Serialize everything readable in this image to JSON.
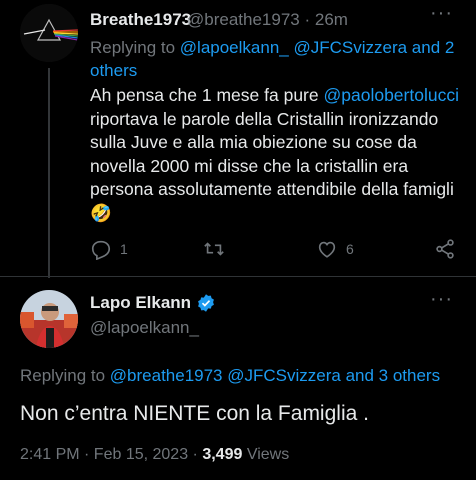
{
  "reply_tweet": {
    "display_name": "Breathe1973",
    "handle": "@breathe1973",
    "time": "26m",
    "replying_prefix": "Replying to ",
    "replying_to": "@lapoelkann_ @JFCSvizzera and 2 others",
    "mention": "@paolobertolucci",
    "text": " riportava le parole della Cristallin ironizzando sulla Juve e alla mia obiezione su cose da novella 2000 mi disse che la cristallin era persona assolutamente attendibile della famigli",
    "text_prefix": "Ah pensa che 1 mese fa pure ",
    "emoji": "🤣",
    "reply_count": "1",
    "retweet_count": "",
    "like_count": "6"
  },
  "main_tweet": {
    "display_name": "Lapo Elkann",
    "handle": "@lapoelkann_",
    "replying_prefix": "Replying to ",
    "replying_to": "@breathe1973 @JFCSvizzera and 3 others",
    "text": "Non c’entra NIENTE con la Famiglia .",
    "timestamp": "2:41 PM · Feb 15, 2023 · ",
    "views_count": "3,499",
    "views_label": " Views"
  },
  "icons": {
    "more": "more-dots-icon",
    "reply": "reply-icon",
    "retweet": "retweet-icon",
    "like": "heart-icon",
    "share": "share-icon",
    "verified": "verified-badge-icon"
  },
  "colors": {
    "background": "#000000",
    "text": "#e7e9ea",
    "muted": "#71767b",
    "link": "#1d9bf0"
  }
}
